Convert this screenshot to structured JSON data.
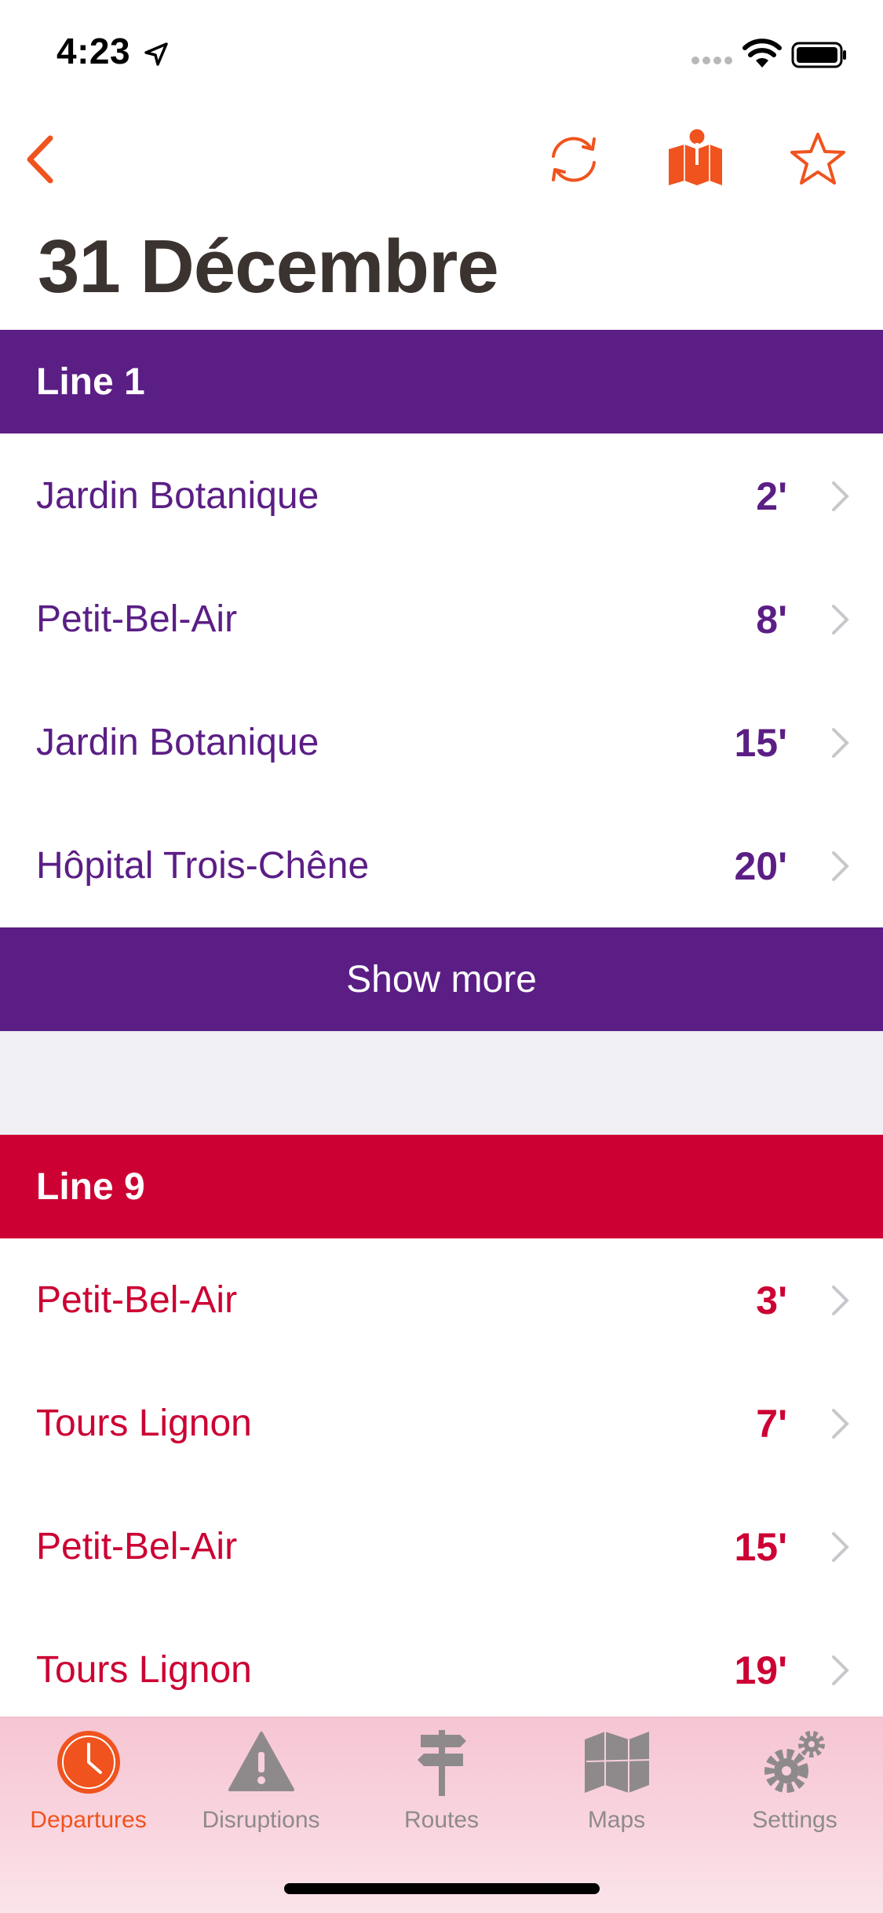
{
  "status_bar": {
    "time": "4:23"
  },
  "nav": {
    "title": "31 Décembre"
  },
  "colors": {
    "accent": "#f0531e",
    "line1": "#5b1e85",
    "line9": "#cc0033",
    "title": "#3b3330"
  },
  "line1": {
    "header": "Line 1",
    "departures": [
      {
        "destination": "Jardin Botanique",
        "minutes": "2'"
      },
      {
        "destination": "Petit-Bel-Air",
        "minutes": "8'"
      },
      {
        "destination": "Jardin Botanique",
        "minutes": "15'"
      },
      {
        "destination": "Hôpital Trois-Chêne",
        "minutes": "20'"
      }
    ],
    "show_more": "Show more"
  },
  "line9": {
    "header": "Line 9",
    "departures": [
      {
        "destination": "Petit-Bel-Air",
        "minutes": "3'"
      },
      {
        "destination": "Tours Lignon",
        "minutes": "7'"
      },
      {
        "destination": "Petit-Bel-Air",
        "minutes": "15'"
      },
      {
        "destination": "Tours Lignon",
        "minutes": "19'"
      }
    ]
  },
  "tabs": [
    {
      "label": "Departures",
      "icon": "clock-icon",
      "active": true
    },
    {
      "label": "Disruptions",
      "icon": "warning-icon",
      "active": false
    },
    {
      "label": "Routes",
      "icon": "signpost-icon",
      "active": false
    },
    {
      "label": "Maps",
      "icon": "map-icon",
      "active": false
    },
    {
      "label": "Settings",
      "icon": "gears-icon",
      "active": false
    }
  ]
}
